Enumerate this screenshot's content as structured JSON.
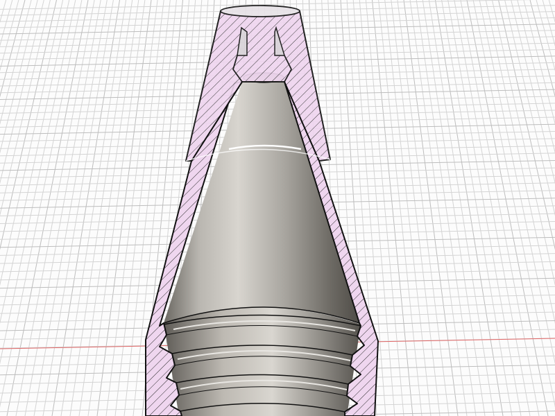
{
  "viewport": {
    "background": "#fcfcfc",
    "grid_color": "#d4d4d4",
    "grid_major_color": "#bdbdbd",
    "axis_x_color": "#e06666"
  },
  "model": {
    "section_fill": "#efd6ef",
    "section_hatch": "#2a2a2a",
    "outline": "#111111",
    "bore_light": "#cfccc6",
    "bore_dark": "#5d5a54",
    "highlight": "#ffffff"
  }
}
